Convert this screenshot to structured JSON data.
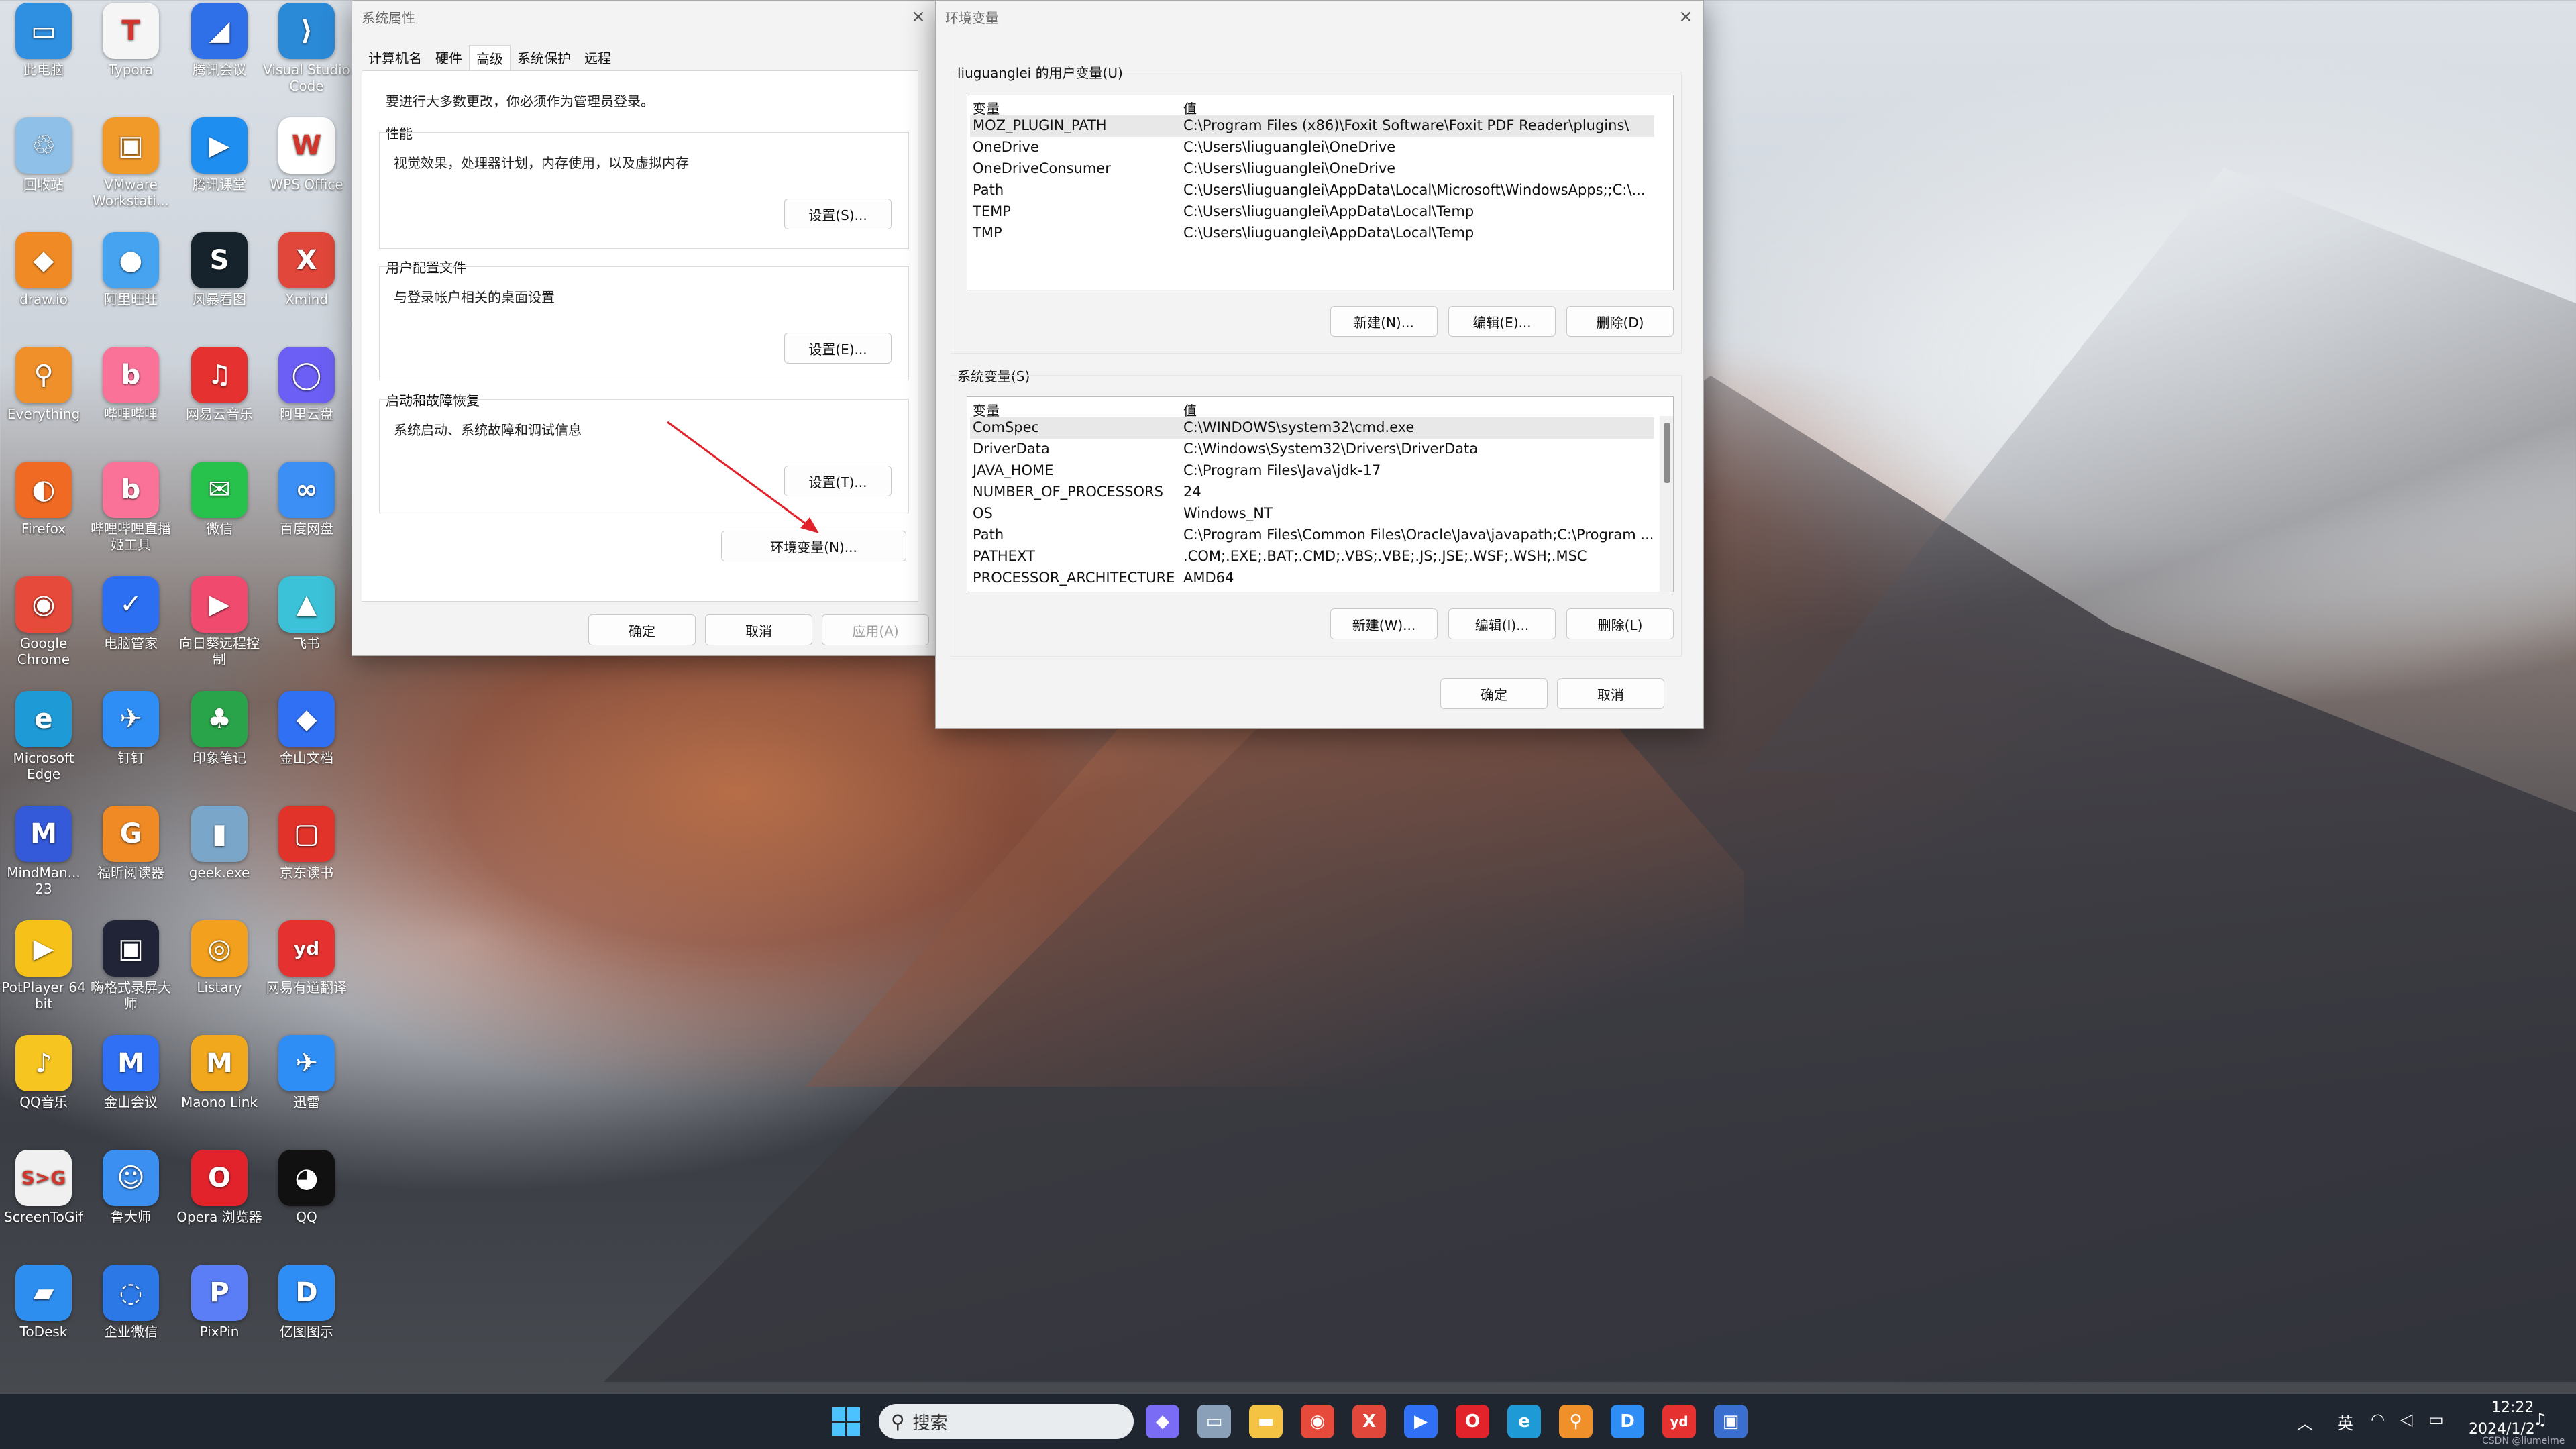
{
  "desktop": {
    "icons": [
      {
        "label": "此电脑",
        "glyph": "▭",
        "color": "#2f8fe0"
      },
      {
        "label": "Typora",
        "glyph": "T",
        "color": "#f5f5f5"
      },
      {
        "label": "腾讯会议",
        "glyph": "◢",
        "color": "#2f6fe8"
      },
      {
        "label": "Visual Studio Code",
        "glyph": "⟩",
        "color": "#2a8ad8"
      },
      {
        "label": "回收站",
        "glyph": "♲",
        "color": "#8fc1e8"
      },
      {
        "label": "VMware Workstati...",
        "glyph": "▣",
        "color": "#f19a2a"
      },
      {
        "label": "腾讯课堂",
        "glyph": "▶",
        "color": "#1f8ef1"
      },
      {
        "label": "WPS Office",
        "glyph": "W",
        "color": "#ffffff"
      },
      {
        "label": "draw.io",
        "glyph": "◆",
        "color": "#f08a24"
      },
      {
        "label": "阿里旺旺",
        "glyph": "●",
        "color": "#45a3f0"
      },
      {
        "label": "风暴看图",
        "glyph": "S",
        "color": "#16232c"
      },
      {
        "label": "Xmind",
        "glyph": "X",
        "color": "#e2473b"
      },
      {
        "label": "Everything",
        "glyph": "⚲",
        "color": "#f0902a"
      },
      {
        "label": "哔哩哔哩",
        "glyph": "b",
        "color": "#fb7299"
      },
      {
        "label": "网易云音乐",
        "glyph": "♫",
        "color": "#e5312f"
      },
      {
        "label": "阿里云盘",
        "glyph": "◯",
        "color": "#6c5ff5"
      },
      {
        "label": "Firefox",
        "glyph": "◐",
        "color": "#f06a23"
      },
      {
        "label": "哔哩哔哩直播姬工具",
        "glyph": "b",
        "color": "#fb7299"
      },
      {
        "label": "微信",
        "glyph": "✉",
        "color": "#27c24c"
      },
      {
        "label": "百度网盘",
        "glyph": "∞",
        "color": "#3b8ff5"
      },
      {
        "label": "Google Chrome",
        "glyph": "◉",
        "color": "#e64a3a"
      },
      {
        "label": "电脑管家",
        "glyph": "✓",
        "color": "#2c6ff2"
      },
      {
        "label": "向日葵远程控制",
        "glyph": "▶",
        "color": "#f04b6e"
      },
      {
        "label": "飞书",
        "glyph": "▲",
        "color": "#3cc2d8"
      },
      {
        "label": "Microsoft Edge",
        "glyph": "e",
        "color": "#1e9bd7"
      },
      {
        "label": "钉钉",
        "glyph": "✈",
        "color": "#2f8ef5"
      },
      {
        "label": "印象笔记",
        "glyph": "♣",
        "color": "#2aa44a"
      },
      {
        "label": "金山文档",
        "glyph": "◆",
        "color": "#2f70f5"
      },
      {
        "label": "MindMan... 23",
        "glyph": "M",
        "color": "#3459d9"
      },
      {
        "label": "福昕阅读器",
        "glyph": "G",
        "color": "#f08a24"
      },
      {
        "label": "geek.exe",
        "glyph": "▮",
        "color": "#7aa7c9"
      },
      {
        "label": "京东读书",
        "glyph": "▢",
        "color": "#e2332b"
      },
      {
        "label": "PotPlayer 64 bit",
        "glyph": "▶",
        "color": "#f6c21a"
      },
      {
        "label": "嗨格式录屏大师",
        "glyph": "▣",
        "color": "#202436"
      },
      {
        "label": "Listary",
        "glyph": "◎",
        "color": "#f2a01d"
      },
      {
        "label": "网易有道翻译",
        "glyph": "yd",
        "color": "#e5312f"
      },
      {
        "label": "QQ音乐",
        "glyph": "♪",
        "color": "#f7c520"
      },
      {
        "label": "金山会议",
        "glyph": "M",
        "color": "#2f70f5"
      },
      {
        "label": "Maono Link",
        "glyph": "M",
        "color": "#f2a81d"
      },
      {
        "label": "迅雷",
        "glyph": "✈",
        "color": "#2f8ef5"
      },
      {
        "label": "ScreenToGif",
        "glyph": "S>G",
        "color": "#f0f0f0"
      },
      {
        "label": "鲁大师",
        "glyph": "☺",
        "color": "#3a8ff0"
      },
      {
        "label": "Opera 浏览器",
        "glyph": "O",
        "color": "#e2232c"
      },
      {
        "label": "QQ",
        "glyph": "◕",
        "color": "#111111"
      },
      {
        "label": "ToDesk",
        "glyph": "▰",
        "color": "#2e8ef0"
      },
      {
        "label": "企业微信",
        "glyph": "◌",
        "color": "#2b78e6"
      },
      {
        "label": "PixPin",
        "glyph": "P",
        "color": "#5b7df5"
      },
      {
        "label": "亿图图示",
        "glyph": "D",
        "color": "#2f8ef5"
      }
    ]
  },
  "sysprops": {
    "title": "系统属性",
    "tabs": [
      "计算机名",
      "硬件",
      "高级",
      "系统保护",
      "远程"
    ],
    "admin_note": "要进行大多数更改，你必须作为管理员登录。",
    "perf": {
      "title": "性能",
      "desc": "视觉效果，处理器计划，内存使用，以及虚拟内存",
      "button": "设置(S)..."
    },
    "profile": {
      "title": "用户配置文件",
      "desc": "与登录帐户相关的桌面设置",
      "button": "设置(E)..."
    },
    "startup": {
      "title": "启动和故障恢复",
      "desc": "系统启动、系统故障和调试信息",
      "button": "设置(T)..."
    },
    "env_button": "环境变量(N)...",
    "ok": "确定",
    "cancel": "取消",
    "apply": "应用(A)"
  },
  "envvars": {
    "title": "环境变量",
    "user_group": "liuguanglei 的用户变量(U)",
    "col_var": "变量",
    "col_val": "值",
    "user_vars": [
      {
        "name": "MOZ_PLUGIN_PATH",
        "value": "C:\\Program Files (x86)\\Foxit Software\\Foxit PDF Reader\\plugins\\"
      },
      {
        "name": "OneDrive",
        "value": "C:\\Users\\liuguanglei\\OneDrive"
      },
      {
        "name": "OneDriveConsumer",
        "value": "C:\\Users\\liuguanglei\\OneDrive"
      },
      {
        "name": "Path",
        "value": "C:\\Users\\liuguanglei\\AppData\\Local\\Microsoft\\WindowsApps;;C:\\..."
      },
      {
        "name": "TEMP",
        "value": "C:\\Users\\liuguanglei\\AppData\\Local\\Temp"
      },
      {
        "name": "TMP",
        "value": "C:\\Users\\liuguanglei\\AppData\\Local\\Temp"
      }
    ],
    "user_buttons": {
      "new": "新建(N)...",
      "edit": "编辑(E)...",
      "delete": "删除(D)"
    },
    "sys_group": "系统变量(S)",
    "sys_vars": [
      {
        "name": "ComSpec",
        "value": "C:\\WINDOWS\\system32\\cmd.exe"
      },
      {
        "name": "DriverData",
        "value": "C:\\Windows\\System32\\Drivers\\DriverData"
      },
      {
        "name": "JAVA_HOME",
        "value": "C:\\Program Files\\Java\\jdk-17"
      },
      {
        "name": "NUMBER_OF_PROCESSORS",
        "value": "24"
      },
      {
        "name": "OS",
        "value": "Windows_NT"
      },
      {
        "name": "Path",
        "value": "C:\\Program Files\\Common Files\\Oracle\\Java\\javapath;C:\\Program ..."
      },
      {
        "name": "PATHEXT",
        "value": ".COM;.EXE;.BAT;.CMD;.VBS;.VBE;.JS;.JSE;.WSF;.WSH;.MSC"
      },
      {
        "name": "PROCESSOR_ARCHITECTURE",
        "value": "AMD64"
      }
    ],
    "sys_buttons": {
      "new": "新建(W)...",
      "edit": "编辑(I)...",
      "delete": "删除(L)"
    },
    "ok": "确定",
    "cancel": "取消"
  },
  "taskbar": {
    "search_placeholder": "搜索",
    "ime": "英",
    "time": "12:22",
    "date": "2024/1/2",
    "watermark": "CSDN @liumeime",
    "pinned": [
      {
        "name": "copilot",
        "glyph": "◆",
        "color": "#7b6cf6"
      },
      {
        "name": "task-view",
        "glyph": "▭",
        "color": "#8aa0b8"
      },
      {
        "name": "file-explorer",
        "glyph": "▬",
        "color": "#f5c343"
      },
      {
        "name": "chrome",
        "glyph": "◉",
        "color": "#e64a3a"
      },
      {
        "name": "xmind",
        "glyph": "X",
        "color": "#e2473b"
      },
      {
        "name": "meeting",
        "glyph": "▶",
        "color": "#2f70f5"
      },
      {
        "name": "opera",
        "glyph": "O",
        "color": "#e2232c"
      },
      {
        "name": "edge",
        "glyph": "e",
        "color": "#1e9bd7"
      },
      {
        "name": "everything",
        "glyph": "⚲",
        "color": "#f0902a"
      },
      {
        "name": "edraw",
        "glyph": "D",
        "color": "#2f8ef5"
      },
      {
        "name": "youdao",
        "glyph": "yd",
        "color": "#e5312f"
      },
      {
        "name": "system-properties",
        "glyph": "▣",
        "color": "#3a6fcf"
      }
    ]
  },
  "colors": {
    "accent": "#0067c0",
    "taskbar": "#1f2630"
  }
}
